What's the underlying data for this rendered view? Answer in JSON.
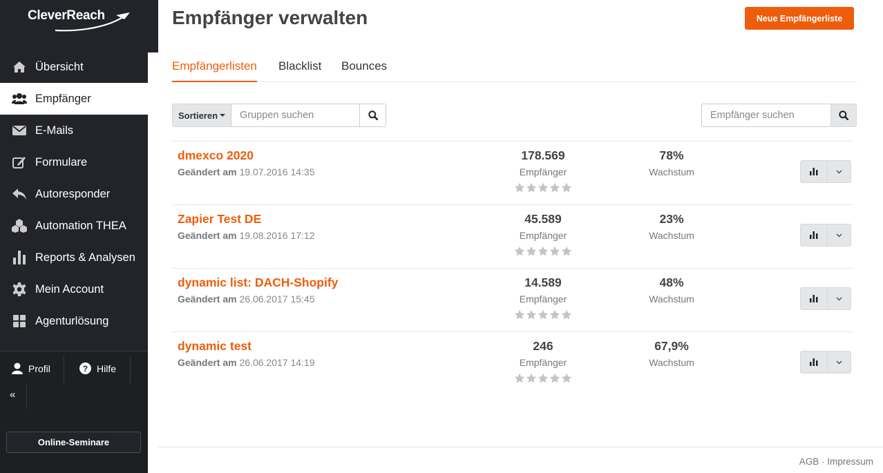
{
  "brand": {
    "name": "CleverReach"
  },
  "sidebar": {
    "items": [
      {
        "label": "Übersicht",
        "icon": "home-icon"
      },
      {
        "label": "Empfänger",
        "icon": "users-icon",
        "active": true
      },
      {
        "label": "E-Mails",
        "icon": "envelope-icon"
      },
      {
        "label": "Formulare",
        "icon": "edit-icon"
      },
      {
        "label": "Autoresponder",
        "icon": "reply-icon"
      },
      {
        "label": "Automation THEA",
        "icon": "cubes-icon"
      },
      {
        "label": "Reports & Analysen",
        "icon": "bar-chart-icon"
      },
      {
        "label": "Mein Account",
        "icon": "gear-icon"
      },
      {
        "label": "Agenturlösung",
        "icon": "grid-icon"
      }
    ],
    "profile_label": "Profil",
    "help_label": "Hilfe",
    "collapse_label": "«",
    "seminar_label": "Online-Seminare"
  },
  "header": {
    "title": "Empfänger verwalten",
    "new_list_label": "Neue Empfängerliste"
  },
  "tabs": [
    {
      "label": "Empfängerlisten",
      "active": true
    },
    {
      "label": "Blacklist"
    },
    {
      "label": "Bounces"
    }
  ],
  "toolbar": {
    "sort_label": "Sortieren",
    "group_search_placeholder": "Gruppen suchen",
    "recipient_search_placeholder": "Empfänger suchen"
  },
  "lists": [
    {
      "name": "dmexco 2020",
      "changed_label": "Geändert am",
      "changed": "19.07.2016 14:35",
      "count": "178.569",
      "count_label": "Empfänger",
      "growth": "78%",
      "growth_label": "Wachstum",
      "rating": 0
    },
    {
      "name": "Zapier Test DE",
      "changed_label": "Geändert am",
      "changed": "19.08.2016 17:12",
      "count": "45.589",
      "count_label": "Empfänger",
      "growth": "23%",
      "growth_label": "Wachstum",
      "rating": 0
    },
    {
      "name": "dynamic list: DACH-Shopify",
      "changed_label": "Geändert am",
      "changed": "26.06.2017 15:45",
      "count": "14.589",
      "count_label": "Empfänger",
      "growth": "48%",
      "growth_label": "Wachstum",
      "rating": 0
    },
    {
      "name": "dynamic test",
      "changed_label": "Geändert am",
      "changed": "26.06.2017 14:19",
      "count": "246",
      "count_label": "Empfänger",
      "growth": "67,9%",
      "growth_label": "Wachstum",
      "rating": 0
    }
  ],
  "footer": {
    "agb": "AGB",
    "separator": "·",
    "impressum": "Impressum"
  },
  "colors": {
    "accent": "#ee5d0b",
    "sidebar_bg": "#222429"
  }
}
